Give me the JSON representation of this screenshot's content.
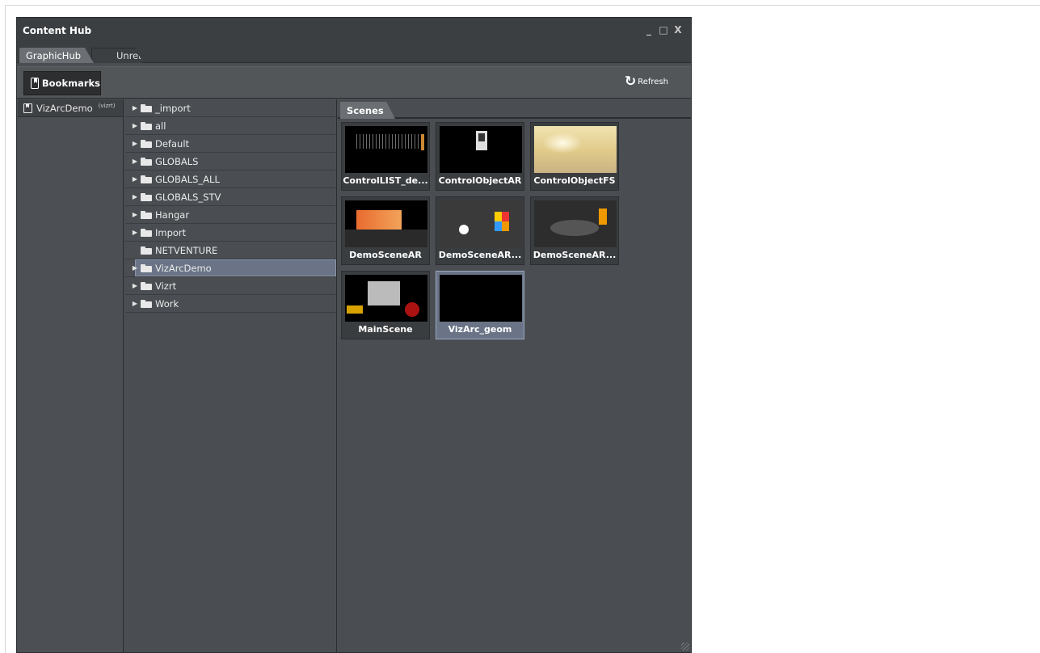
{
  "window": {
    "title": "Content Hub",
    "controls": {
      "minimize": "_",
      "maximize": "□",
      "close": "X"
    }
  },
  "tabs": [
    {
      "label": "GraphicHub",
      "active": true
    },
    {
      "label": "Unreal",
      "active": false
    }
  ],
  "toolbar": {
    "bookmarks_label": "Bookmarks",
    "refresh_label": "Refresh"
  },
  "bookmarks": [
    {
      "label": "VizArcDemo",
      "tag": "(vizrt)"
    }
  ],
  "tree": [
    {
      "label": "_import",
      "expandable": true,
      "selected": false
    },
    {
      "label": "all",
      "expandable": true,
      "selected": false
    },
    {
      "label": "Default",
      "expandable": true,
      "selected": false
    },
    {
      "label": "GLOBALS",
      "expandable": true,
      "selected": false
    },
    {
      "label": "GLOBALS_ALL",
      "expandable": true,
      "selected": false
    },
    {
      "label": "GLOBALS_STV",
      "expandable": true,
      "selected": false
    },
    {
      "label": "Hangar",
      "expandable": true,
      "selected": false
    },
    {
      "label": "Import",
      "expandable": true,
      "selected": false
    },
    {
      "label": "NETVENTURE",
      "expandable": false,
      "selected": false
    },
    {
      "label": "VizArcDemo",
      "expandable": true,
      "selected": true
    },
    {
      "label": "Vizrt",
      "expandable": true,
      "selected": false
    },
    {
      "label": "Work",
      "expandable": true,
      "selected": false
    }
  ],
  "scenes_tab": "Scenes",
  "scenes": [
    {
      "label": "ControlLIST_de...",
      "selected": false
    },
    {
      "label": "ControlObjectAR",
      "selected": false
    },
    {
      "label": "ControlObjectFS",
      "selected": false
    },
    {
      "label": "DemoSceneAR",
      "selected": false
    },
    {
      "label": "DemoSceneAR...",
      "selected": false
    },
    {
      "label": "DemoSceneAR...",
      "selected": false
    },
    {
      "label": "MainScene",
      "selected": false
    },
    {
      "label": "VizArc_geom",
      "selected": true
    }
  ],
  "colors": {
    "window_bg": "#4a4e52",
    "titlebar_bg": "#3c3f42",
    "selection": "#6a7486"
  }
}
